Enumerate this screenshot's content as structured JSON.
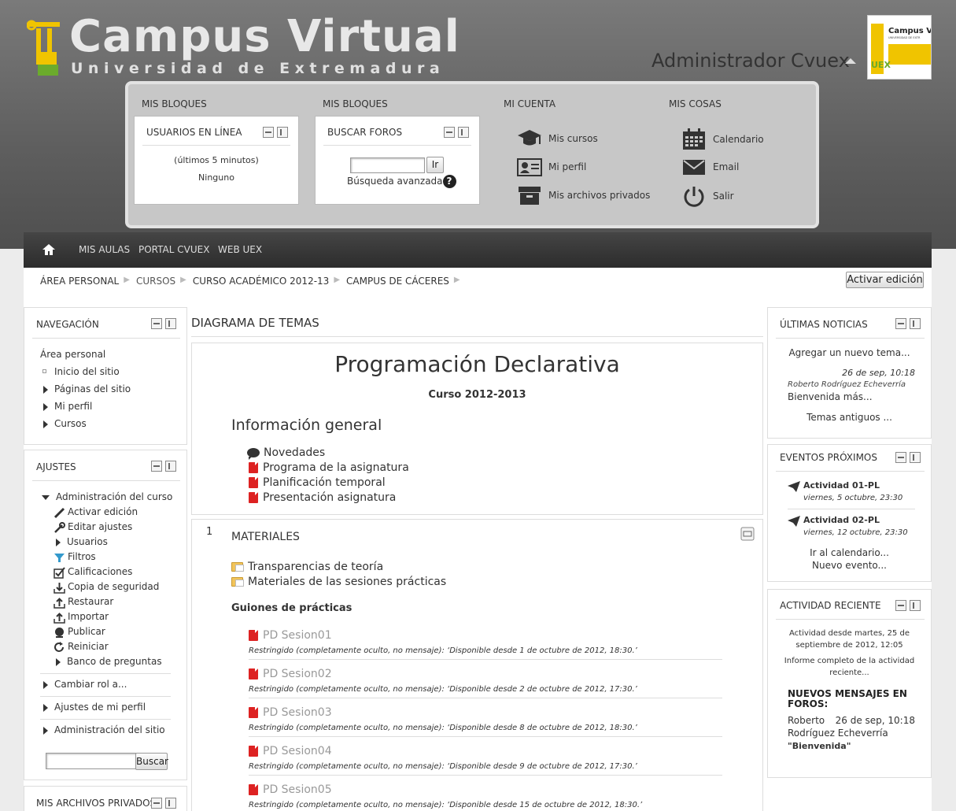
{
  "header": {
    "logo_title": "Campus Virtual",
    "logo_subtitle": "Universidad de Extremadura",
    "logo_mark": "UEX",
    "user_name": "Administrador Cvuex",
    "badge_title": "Campus Vi",
    "badge_sub": "UNIVERSIDAD DE EXTR",
    "badge_mark": "UEX"
  },
  "panel": {
    "col1_heading": "MIS BLOQUES",
    "col2_heading": "MIS BLOQUES",
    "col3_heading": "MI CUENTA",
    "col4_heading": "MIS COSAS",
    "online_block": {
      "title": "USUARIOS EN LÍNEA",
      "line1": "(últimos 5 minutos)",
      "line2": "Ninguno"
    },
    "forum_block": {
      "title": "BUSCAR FOROS",
      "button": "Ir",
      "advanced": "Búsqueda avanzada"
    },
    "account_links": [
      "Mis cursos",
      "Mi perfil",
      "Mis archivos privados"
    ],
    "stuff_links": [
      "Calendario",
      "Email",
      "Salir"
    ]
  },
  "navbar": {
    "items": [
      "MIS AULAS",
      "PORTAL CVUEX",
      "WEB UEX"
    ]
  },
  "breadcrumb": [
    "ÁREA PERSONAL",
    "CURSOS",
    "CURSO ACADÉMICO 2012-13",
    "CAMPUS DE CÁCERES"
  ],
  "edit_button": "Activar edición",
  "navigation": {
    "title": "NAVEGACIÓN",
    "home": "Área personal",
    "items": [
      "Inicio del sitio",
      "Páginas del sitio",
      "Mi perfil",
      "Cursos"
    ]
  },
  "settings": {
    "title": "AJUSTES",
    "course_admin": "Administración del curso",
    "items": [
      "Activar edición",
      "Editar ajustes",
      "Usuarios",
      "Filtros",
      "Calificaciones",
      "Copia de seguridad",
      "Restaurar",
      "Importar",
      "Publicar",
      "Reiniciar",
      "Banco de preguntas"
    ],
    "switch_role": "Cambiar rol a...",
    "profile_settings": "Ajustes de mi perfil",
    "site_admin": "Administración del sitio",
    "search_button": "Buscar"
  },
  "private_files": {
    "title": "MIS ARCHIVOS PRIVADOS"
  },
  "course": {
    "section_heading": "DIAGRAMA DE TEMAS",
    "title": "Programación Declarativa",
    "year": "Curso 2012-2013",
    "general_heading": "Información general",
    "general_items": [
      "Novedades",
      "Programa de la asignatura",
      "Planificación temporal",
      "Presentación asignatura"
    ],
    "topic_number": "1",
    "topic_title": "MATERIALES",
    "materials": [
      "Transparencias de teoría",
      "Materiales de las sesiones prácticas"
    ],
    "guides_heading": "Guiones de prácticas",
    "sessions": [
      {
        "name": "PD Sesion01",
        "note": "Restringido (completamente oculto, no mensaje): ‘Disponible desde 1 de octubre de 2012, 18:30.’"
      },
      {
        "name": "PD Sesion02",
        "note": "Restringido (completamente oculto, no mensaje): ‘Disponible desde 2 de octubre de 2012, 17:30.’"
      },
      {
        "name": "PD Sesion03",
        "note": "Restringido (completamente oculto, no mensaje): ‘Disponible desde 8 de octubre de 2012, 18:30.’"
      },
      {
        "name": "PD Sesion04",
        "note": "Restringido (completamente oculto, no mensaje): ‘Disponible desde 9 de octubre de 2012, 17:30.’"
      },
      {
        "name": "PD Sesion05",
        "note": "Restringido (completamente oculto, no mensaje): ‘Disponible desde 15 de octubre de 2012, 18:30.’"
      }
    ]
  },
  "news": {
    "title": "ÚLTIMAS NOTICIAS",
    "add": "Agregar un nuevo tema...",
    "date": "26 de sep, 10:18",
    "author": "Roberto Rodríguez Echeverría",
    "post": "Bienvenida más...",
    "older": "Temas antiguos ..."
  },
  "events": {
    "title": "EVENTOS PRÓXIMOS",
    "items": [
      {
        "name": "Actividad 01-PL",
        "date": "viernes, 5 octubre, 23:30"
      },
      {
        "name": "Actividad 02-PL",
        "date": "viernes, 12 octubre, 23:30"
      }
    ],
    "calendar": "Ir al calendario...",
    "new_event": "Nuevo evento..."
  },
  "recent": {
    "title": "ACTIVIDAD RECIENTE",
    "since_line1": "Actividad desde martes, 25 de",
    "since_line2": "septiembre de 2012, 12:05",
    "report_line1": "Informe completo de la actividad",
    "report_line2": "reciente...",
    "forum_heading_line1": "NUEVOS MENSAJES EN",
    "forum_heading_line2": "FOROS:",
    "poster_first": "Roberto",
    "poster_last": "Rodríguez Echeverría",
    "post_date": "26 de sep, 10:18",
    "post_title": "\"Bienvenida\""
  },
  "colors": {
    "logo_yellow": "#f0c400",
    "logo_green": "#6bab2c",
    "pdf_red": "#d22222",
    "navbar": "#333333"
  }
}
